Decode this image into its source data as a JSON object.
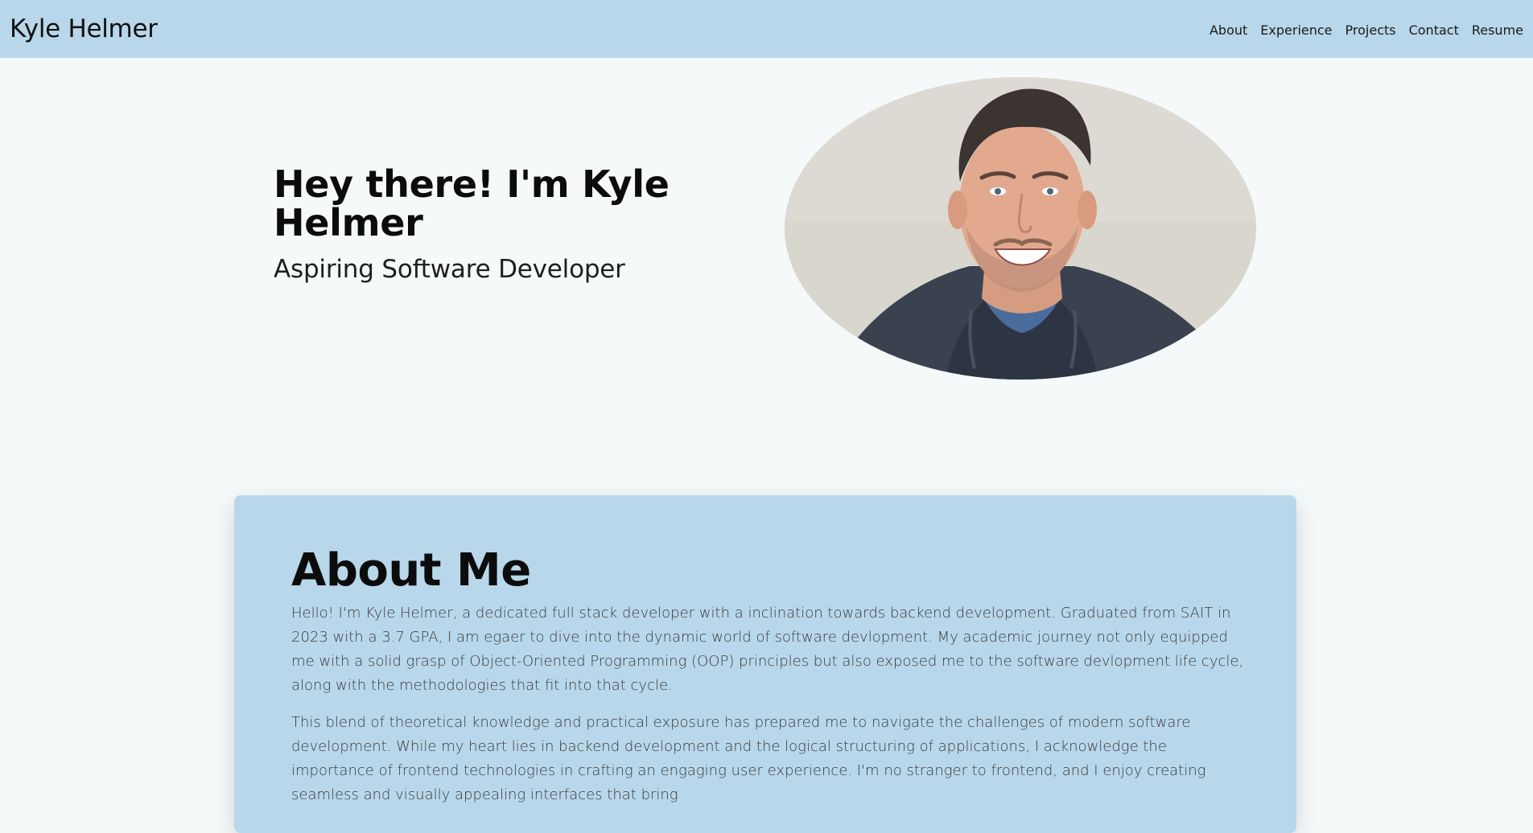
{
  "nav": {
    "brand": "Kyle Helmer",
    "links": [
      {
        "label": "About"
      },
      {
        "label": "Experience"
      },
      {
        "label": "Projects"
      },
      {
        "label": "Contact"
      },
      {
        "label": "Resume"
      }
    ]
  },
  "hero": {
    "title": "Hey there! I'm Kyle Helmer",
    "subtitle": "Aspiring Software Developer",
    "portrait_icon": "portrait-photo"
  },
  "about": {
    "title": "About Me",
    "paragraphs": [
      "Hello! I'm Kyle Helmer, a dedicated full stack developer with a inclination towards backend development. Graduated from SAIT in 2023 with a 3.7 GPA, I am egaer to dive into the dynamic world of software devlopment. My academic journey not only equipped me with a solid grasp of Object-Oriented Programming (OOP) principles but also exposed me to the software devlopment life cycle, along with the methodologies that fit into that cycle.",
      "This blend of theoretical knowledge and practical exposure has prepared me to navigate the challenges of modern software development. While my heart lies in backend development and the logical structuring of applications, I acknowledge the importance of frontend technologies in crafting an engaging user experience. I'm no stranger to frontend, and I enjoy creating seamless and visually appealing interfaces that bring"
    ]
  },
  "colors": {
    "nav_bg": "#b8d7ea",
    "page_bg": "#f5f9fa",
    "card_bg": "#b8d7ea"
  }
}
